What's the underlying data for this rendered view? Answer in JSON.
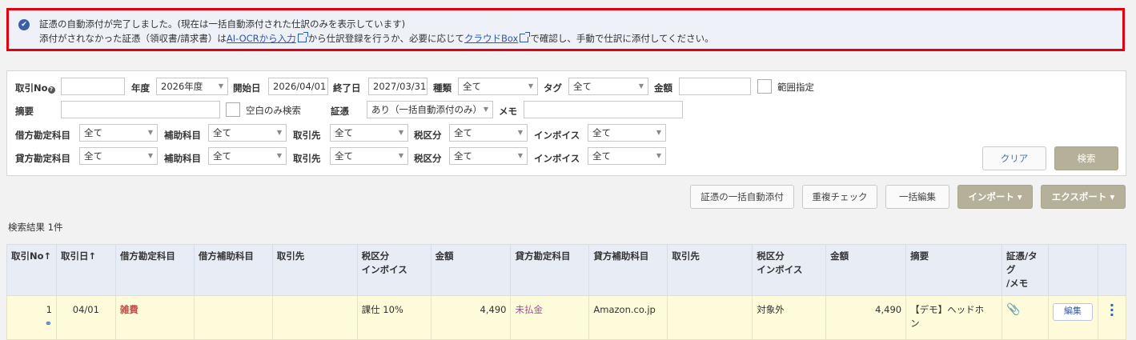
{
  "notice": {
    "line1": "証憑の自動添付が完了しました。(現在は一括自動添付された仕訳のみを表示しています)",
    "line2_pre": "添付がされなかった証憑（領収書/請求書）は",
    "link_ocr": "AI-OCRから入力",
    "line2_mid": "から仕訳登録を行うか、必要に応じて",
    "link_box": "クラウドBox",
    "line2_post": "で確認し、手動で仕訳に添付してください。"
  },
  "form": {
    "torihiki_no_label": "取引No",
    "nendo_label": "年度",
    "nendo_value": "2026年度",
    "start_label": "開始日",
    "start_value": "2026/04/01",
    "end_label": "終了日",
    "end_value": "2027/03/31",
    "shurui_label": "種類",
    "shurui_value": "全て",
    "tag_label": "タグ",
    "tag_value": "全て",
    "kingaku_label": "金額",
    "range_label": "範囲指定",
    "tekiyo_label": "摘要",
    "blank_only_label": "空白のみ検索",
    "shohyo_label": "証憑",
    "shohyo_value": "あり（一括自動添付のみ）",
    "memo_label": "メモ",
    "kari_kamoku_label": "借方勘定科目",
    "kashi_kamoku_label": "貸方勘定科目",
    "hojo_label": "補助科目",
    "torihikisaki_label": "取引先",
    "zeikubun_label": "税区分",
    "invoice_label": "インボイス",
    "all_value": "全て",
    "clear_label": "クリア",
    "search_label": "検索"
  },
  "toolbar": {
    "bulk_attach": "証憑の一括自動添付",
    "dup_check": "重複チェック",
    "bulk_edit": "一括編集",
    "import": "インポート ▾",
    "export": "エクスポート ▾"
  },
  "result_count": "検索結果 1件",
  "table": {
    "headers": {
      "no": "取引No↑",
      "date": "取引日↑",
      "kari_kamoku": "借方勘定科目",
      "kari_hojo": "借方補助科目",
      "kari_torihikisaki": "取引先",
      "kari_zei_1": "税区分",
      "kari_zei_2": "インボイス",
      "kari_kingaku": "金額",
      "kashi_kamoku": "貸方勘定科目",
      "kashi_hojo": "貸方補助科目",
      "kashi_torihikisaki": "取引先",
      "kashi_zei_1": "税区分",
      "kashi_zei_2": "インボイス",
      "kashi_kingaku": "金額",
      "tekiyo": "摘要",
      "shohyo_1": "証憑/タグ",
      "shohyo_2": "/メモ"
    },
    "row": {
      "no": "1",
      "date": "04/01",
      "kari_kamoku": "雑費",
      "kari_zei": "課仕 10%",
      "kari_kingaku": "4,490",
      "kashi_kamoku": "未払金",
      "kashi_hojo": "Amazon.co.jp",
      "kashi_zei": "対象外",
      "kashi_kingaku": "4,490",
      "tekiyo_1": "【デモ】ヘッドホ",
      "tekiyo_2": "ン",
      "edit_label": "編集"
    }
  },
  "colors": {
    "notice_border": "#e0000f",
    "accent": "#b5b09a",
    "row_bg": "#fdfbd9"
  }
}
